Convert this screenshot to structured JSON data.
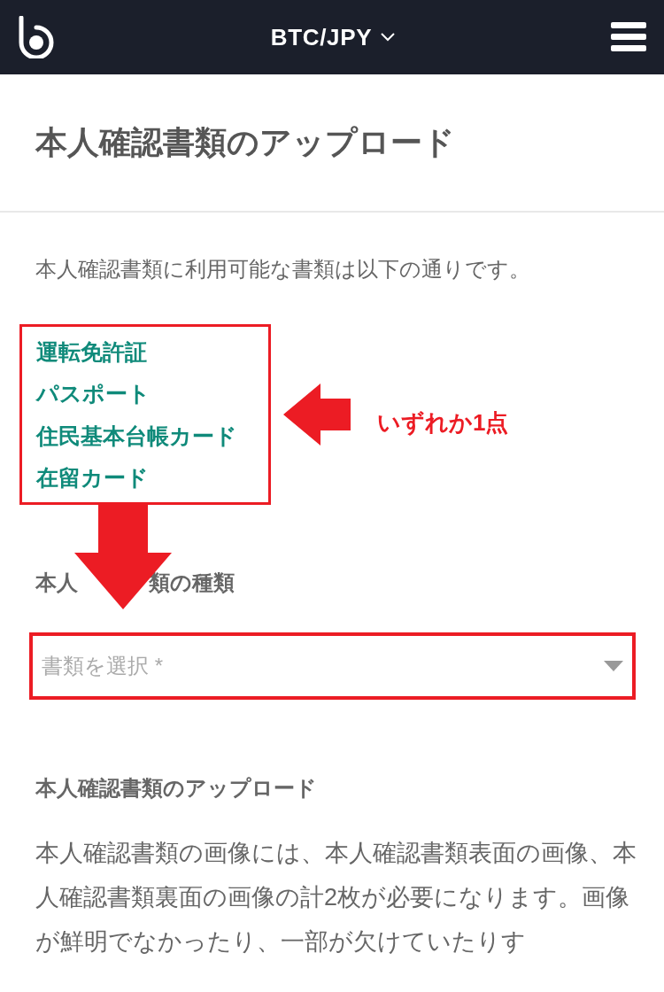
{
  "header": {
    "pair": "BTC/JPY"
  },
  "title": "本人確認書類のアップロード",
  "intro": "本人確認書類に利用可能な書類は以下の通りです。",
  "documents": [
    "運転免許証",
    "パスポート",
    "住民基本台帳カード",
    "在留カード"
  ],
  "annotation": "いずれか1点",
  "type_label_parts": [
    "本人",
    "類の種類"
  ],
  "select": {
    "placeholder": "書類を選択 *"
  },
  "upload_heading": "本人確認書類のアップロード",
  "upload_text": "本人確認書類の画像には、本人確認書類表面の画像、本人確認書類裏面の画像の計2枚が必要になります。画像が鮮明でなかったり、一部が欠けていたりす"
}
